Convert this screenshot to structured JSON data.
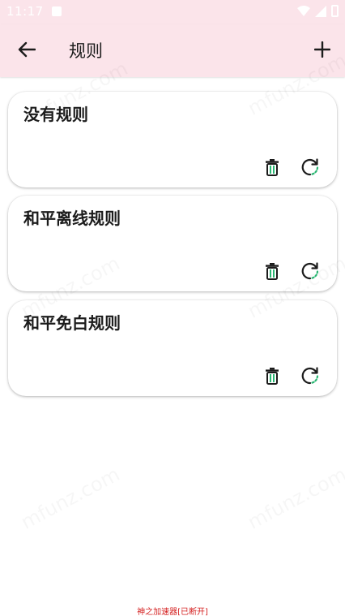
{
  "status_bar": {
    "time": "11:17",
    "icons": [
      "notification-icon",
      "wifi-icon",
      "signal-icon",
      "battery-icon"
    ]
  },
  "app_bar": {
    "back_icon": "arrow-left-icon",
    "title": "规则",
    "add_icon": "plus-icon"
  },
  "rules": [
    {
      "name": "没有规则"
    },
    {
      "name": "和平离线规则"
    },
    {
      "name": "和平免白规则"
    }
  ],
  "card_actions": {
    "delete_icon": "trash-icon",
    "refresh_icon": "refresh-icon"
  },
  "watermark_text": "mfunz.com",
  "footer_note": "神之加速器[已断开]",
  "colors": {
    "header_bg": "#fbe4ea",
    "accent_green": "#2bb673",
    "text_dark": "#1c1c1c",
    "footer_red": "#d42020"
  }
}
